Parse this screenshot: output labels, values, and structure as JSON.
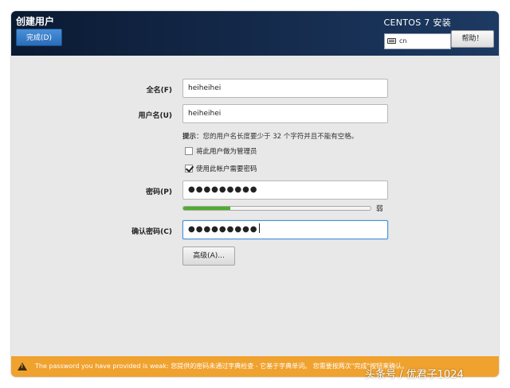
{
  "header": {
    "title": "创建用户",
    "done_button": "完成(D)",
    "product": "CENTOS 7 安装",
    "keyboard_layout": "cn",
    "help_button": "帮助！"
  },
  "form": {
    "full_name": {
      "label": "全名(F)",
      "value": "heiheihei"
    },
    "username": {
      "label": "用户名(U)",
      "value": "heiheihei"
    },
    "hint": {
      "prefix": "提示",
      "text": "：您的用户名长度要少于 32 个字符并且不能有空格。"
    },
    "admin_check": {
      "label": "将此用户做为管理员",
      "checked": false
    },
    "password_check": {
      "label": "使用此帐户需要密码",
      "checked": true
    },
    "password": {
      "label": "密码(P)",
      "value": "●●●●●●●●●"
    },
    "strength": {
      "label": "弱",
      "fraction": 0.25,
      "color": "#4caf2a"
    },
    "confirm": {
      "label": "确认密码(C)",
      "value": "●●●●●●●●●"
    },
    "advanced_button": "高级(A)..."
  },
  "warning": {
    "text": "The password you have provided is weak: 您提供的密码未通过字典检查 - 它基于字典单词。 您需要按两次\"完成\"按钮来确认。"
  },
  "watermark": "头条号 / 优君子1024"
}
